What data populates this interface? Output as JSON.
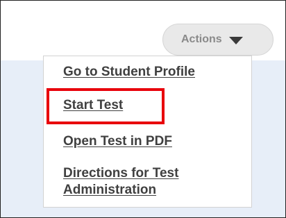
{
  "actions": {
    "label": "Actions",
    "caret_icon": "caret-down-icon"
  },
  "menu": {
    "items": [
      {
        "label": "Go to Student Profile"
      },
      {
        "label": "Start Test"
      },
      {
        "label": "Open Test in PDF"
      },
      {
        "label": "Directions for Test Administration"
      }
    ]
  },
  "highlight": {
    "color": "#e8000b",
    "target": "Start Test"
  }
}
